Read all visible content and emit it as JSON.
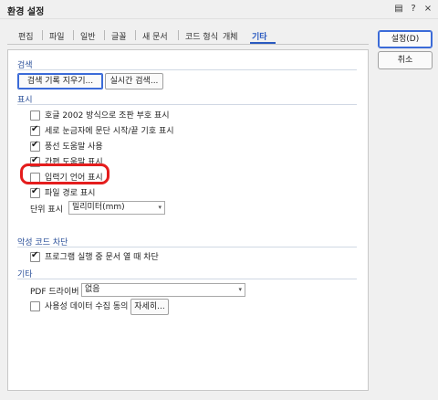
{
  "window": {
    "title": "환경 설정",
    "titlebar_buttons": {
      "help": "?",
      "close": "×",
      "tip": "▤"
    }
  },
  "tabs": [
    {
      "label": "편집",
      "active": false
    },
    {
      "label": "파일",
      "active": false
    },
    {
      "label": "일반",
      "active": false
    },
    {
      "label": "글꼴",
      "active": false
    },
    {
      "label": "새 문서",
      "active": false
    },
    {
      "label": "코드 형식",
      "active": false
    },
    {
      "label": "개체",
      "active": false
    },
    {
      "label": "기타",
      "active": true
    }
  ],
  "sections": {
    "search": {
      "title": "검색",
      "clear_history_button": "검색 기록 지우기...",
      "live_search_button": "실시간 검색..."
    },
    "display": {
      "title": "표시",
      "options": [
        {
          "label": "호글 2002 방식으로 조판 부호 표시",
          "checked": false
        },
        {
          "label": "세로 눈금자에 문단 시작/끝 기호 표시",
          "checked": true
        },
        {
          "label": "풍선 도움말 사용",
          "checked": true
        },
        {
          "label": "간편 도움말 표시",
          "checked": true
        },
        {
          "label": "입력기 언어 표시",
          "checked": false
        },
        {
          "label": "파일 경로 표시",
          "checked": true
        }
      ],
      "unit_label": "단위 표시",
      "unit_value": "밀리미터(mm)"
    },
    "malware": {
      "title": "악성 코드 차단",
      "options": [
        {
          "label": "프로그램 실행 중 문서 열 때 차단",
          "checked": true
        }
      ]
    },
    "etc": {
      "title": "기타",
      "pdf_label": "PDF 드라이버",
      "pdf_value": "없음",
      "usage_label": "사용성 데이터 수집 동의",
      "usage_checked": false,
      "details_button": "자세히..."
    }
  },
  "side_buttons": {
    "ok": "설정(D)",
    "cancel": "취소"
  },
  "colors": {
    "accent": "#2a5ac0",
    "highlight": "#e41d1d"
  },
  "icons": {
    "checkmark": "✔",
    "dropdown": "▾"
  }
}
